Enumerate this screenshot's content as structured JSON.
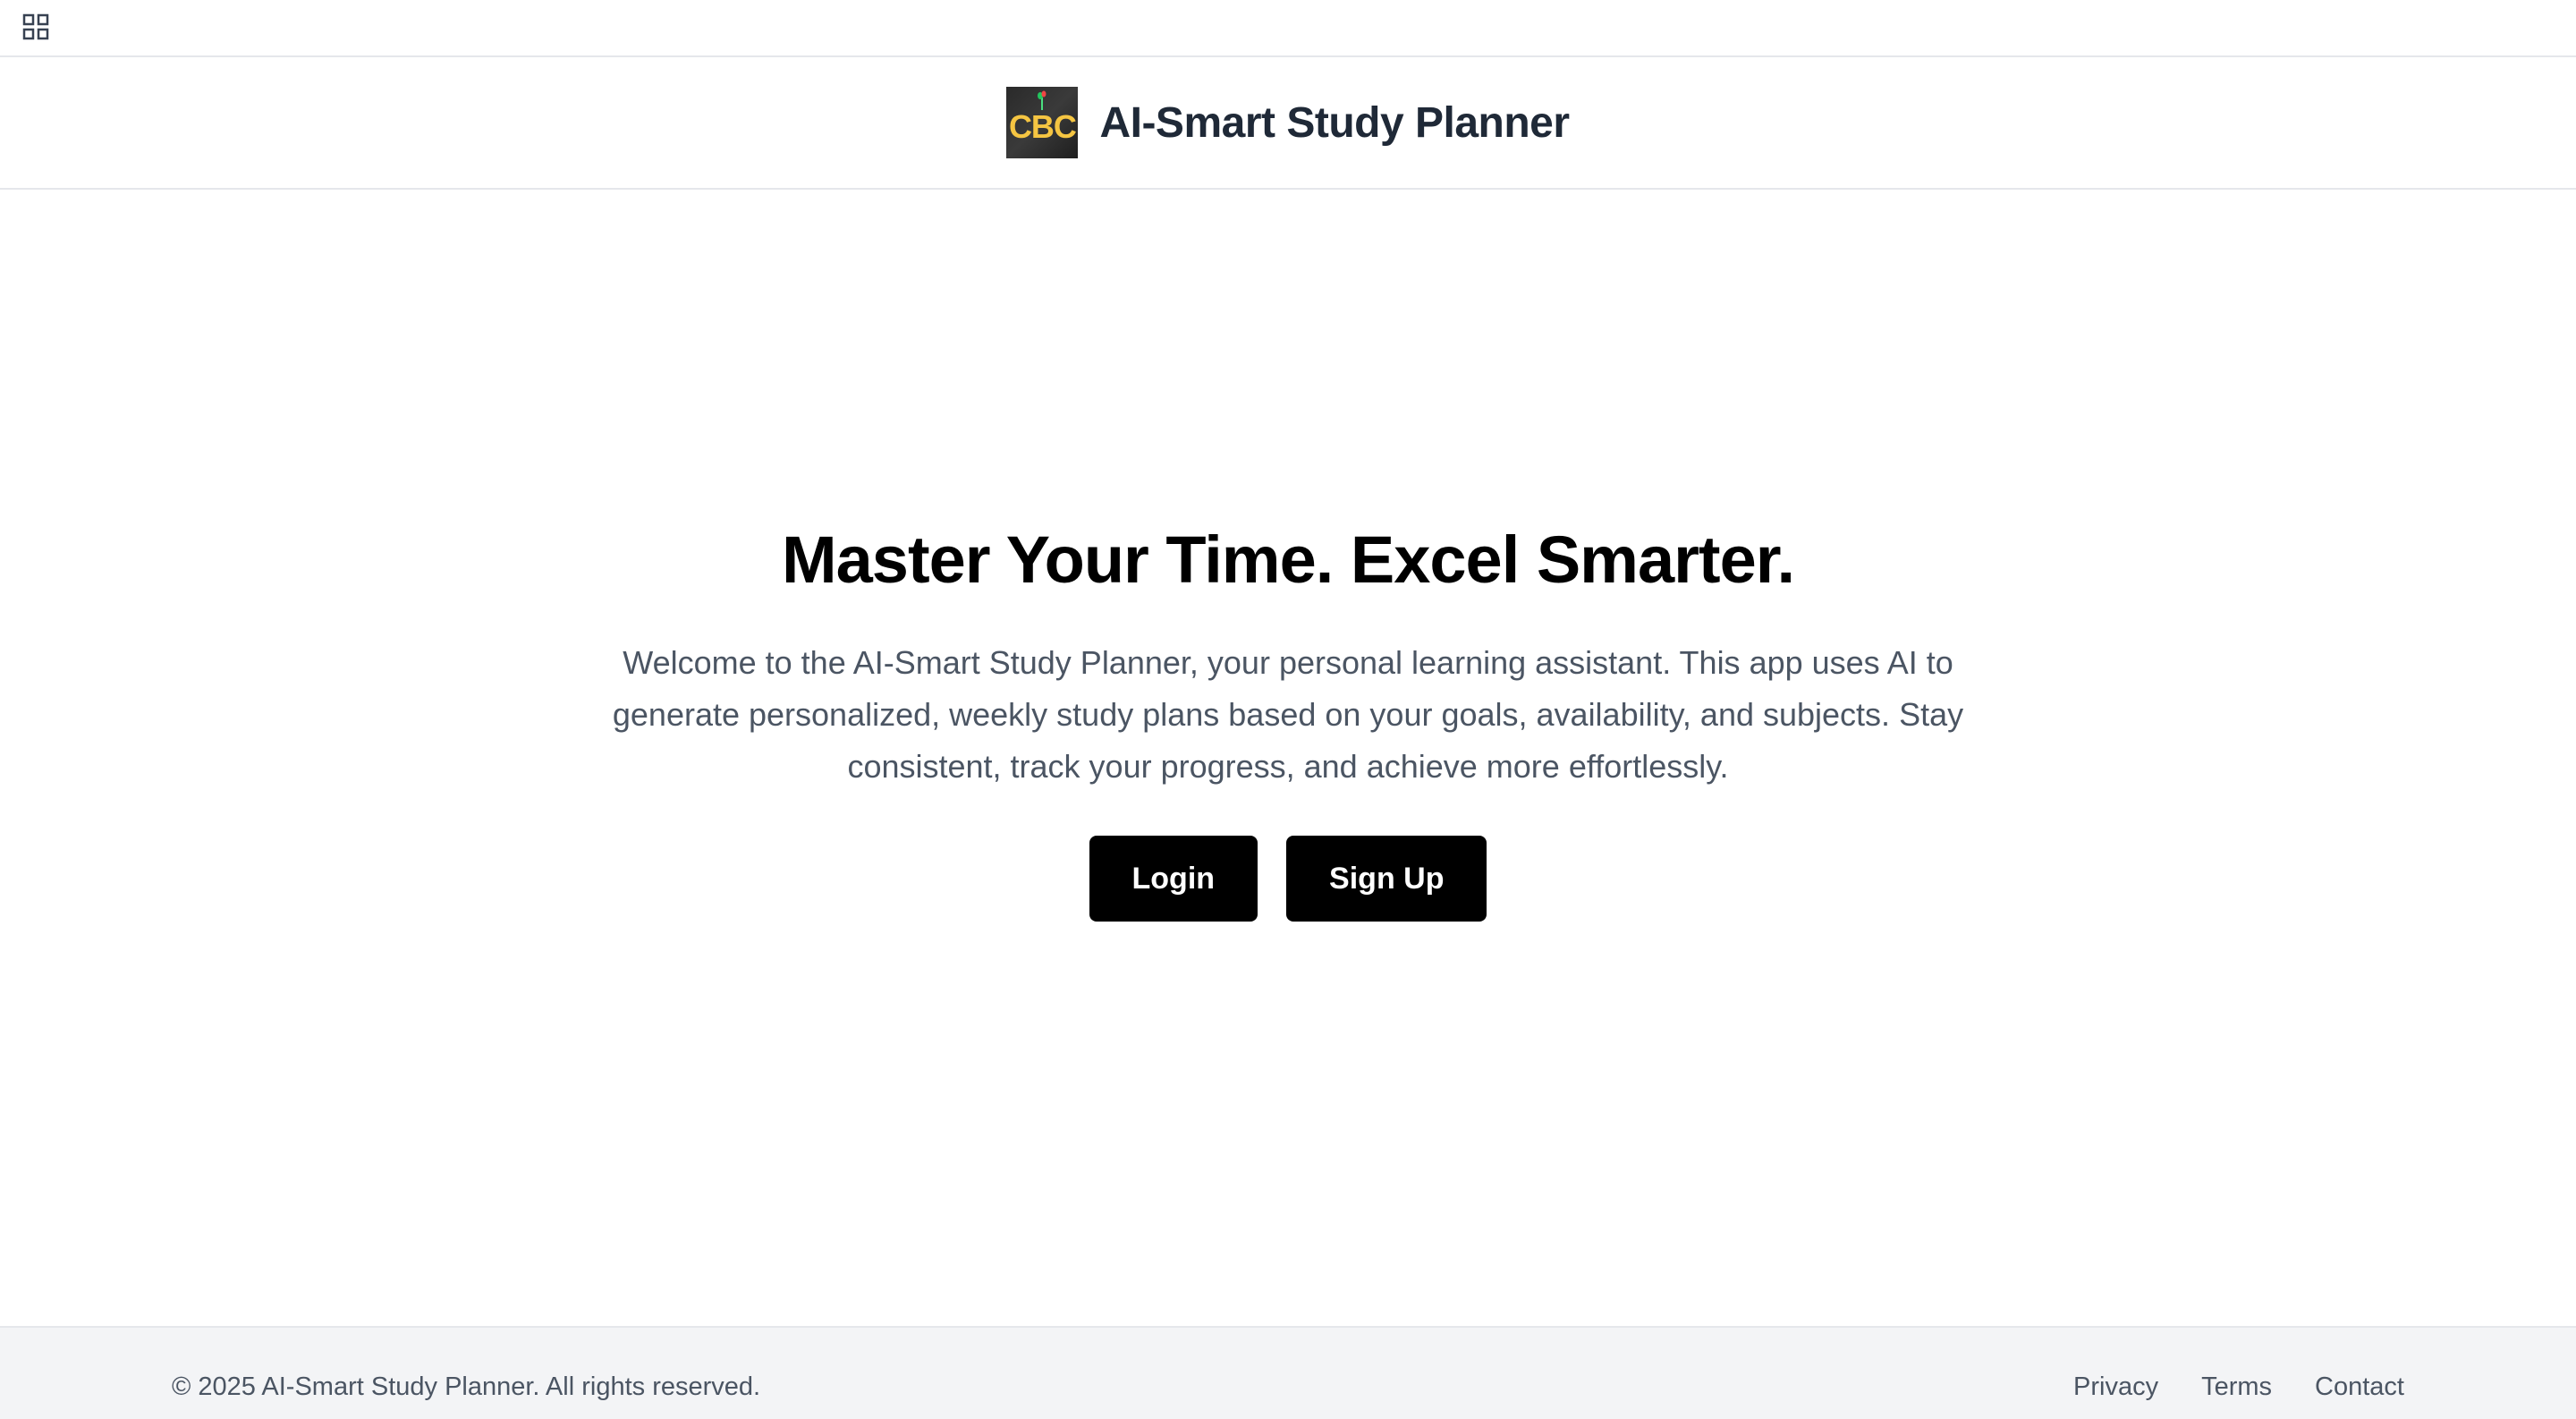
{
  "topbar": {
    "apps_icon": "grid-apps-icon"
  },
  "header": {
    "logo_text": "CBC",
    "title": "AI-Smart Study Planner"
  },
  "hero": {
    "title": "Master Your Time. Excel Smarter.",
    "description": "Welcome to the AI-Smart Study Planner, your personal learning assistant. This app uses AI to generate personalized, weekly study plans based on your goals, availability, and subjects. Stay consistent, track your progress, and achieve more effortlessly.",
    "login_label": "Login",
    "signup_label": "Sign Up"
  },
  "footer": {
    "copyright": "© 2025 AI-Smart Study Planner. All rights reserved.",
    "links": [
      "Privacy",
      "Terms",
      "Contact"
    ]
  },
  "colors": {
    "primary_button": "#000000",
    "title_text": "#1f2937",
    "body_text": "#4b5563",
    "footer_bg": "#f3f4f6",
    "logo_accent": "#f5c542"
  }
}
